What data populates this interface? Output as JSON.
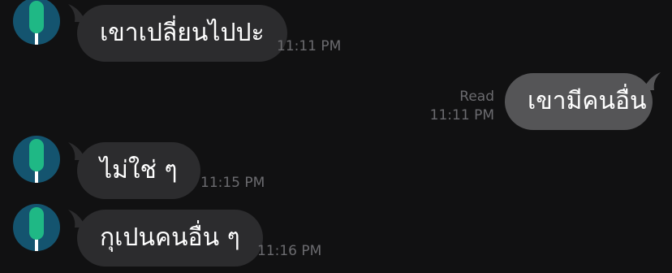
{
  "conversation": {
    "messages": [
      {
        "direction": "incoming",
        "text": "เขาเปลี่ยนไปปะ",
        "time": "11:11 PM"
      },
      {
        "direction": "outgoing",
        "text": "เขามีคนอื่น",
        "status": "Read",
        "time": "11:11 PM"
      },
      {
        "direction": "incoming",
        "text": "ไม่ใช่ ๆ",
        "time": "11:15 PM"
      },
      {
        "direction": "incoming",
        "text": "กุเปนคนอื่น ๆ",
        "time": "11:16 PM"
      }
    ]
  },
  "contact": {
    "avatar_icon": "green-lollipop-icon",
    "avatar_bg": "#14546f",
    "avatar_fg": "#1fb885"
  },
  "colors": {
    "background": "#111112",
    "incoming_bubble": "#2c2c2e",
    "outgoing_bubble": "#555557",
    "timestamp": "#6b6b6f"
  }
}
